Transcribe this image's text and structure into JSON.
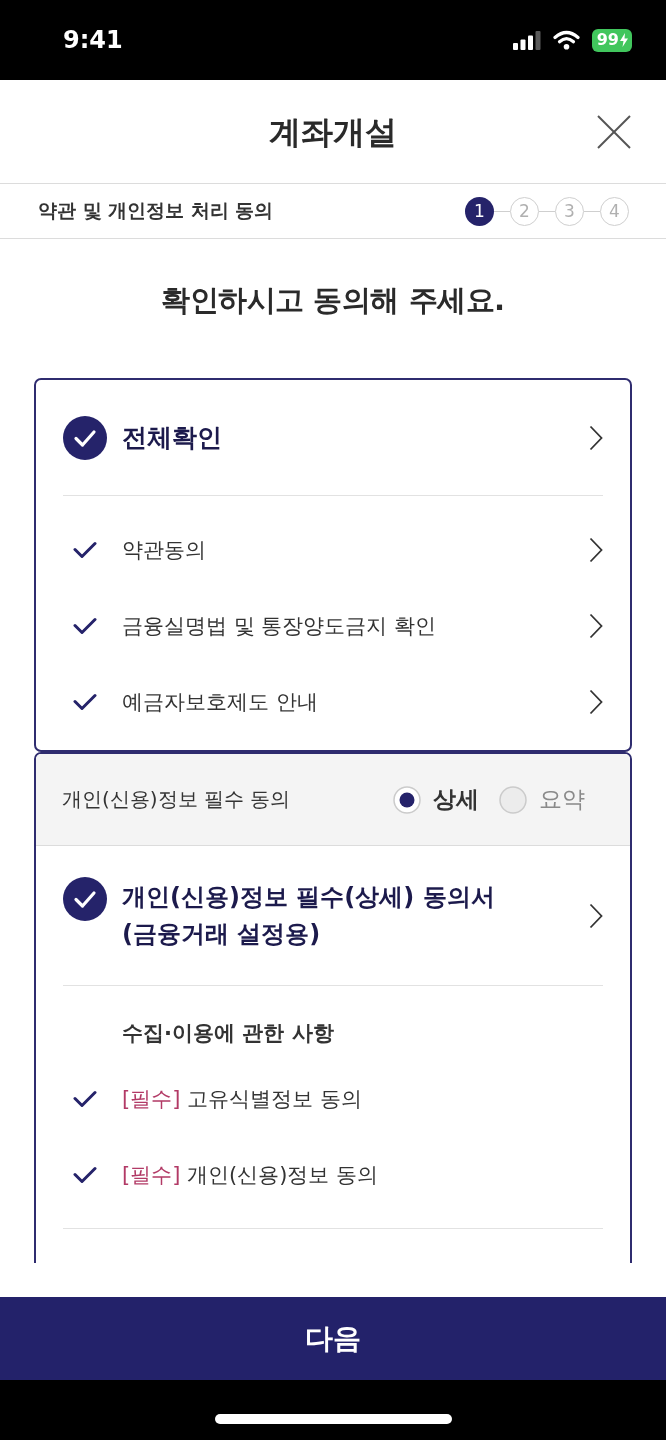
{
  "status_bar": {
    "time": "9:41",
    "battery": "99"
  },
  "header": {
    "title": "계좌개설"
  },
  "stepper": {
    "label": "약관 및 개인정보 처리 동의",
    "steps": [
      {
        "number": "1",
        "selected": true
      },
      {
        "number": "2",
        "selected": false
      },
      {
        "number": "3",
        "selected": false
      },
      {
        "number": "4",
        "selected": false
      }
    ]
  },
  "heading": "확인하시고 동의해 주세요.",
  "agreement_card": {
    "all": {
      "label": "전체확인",
      "checked": true
    },
    "items": [
      {
        "label": "약관동의",
        "checked": true
      },
      {
        "label": "금융실명법 및 통장양도금지 확인",
        "checked": true
      },
      {
        "label": "예금자보호제도 안내",
        "checked": true
      }
    ]
  },
  "personal_info_card": {
    "title": "개인(신용)정보 필수 동의",
    "view_options": [
      {
        "label": "상세",
        "selected": true
      },
      {
        "label": "요약",
        "selected": false
      }
    ],
    "document": {
      "title": "개인(신용)정보 필수(상세) 동의서 (금융거래 설정용)",
      "checked": true
    },
    "sections": [
      {
        "title": "수집·이용에 관한 사항",
        "items": [
          {
            "tag": "[필수]",
            "label": "고유식별정보 동의",
            "checked": true
          },
          {
            "tag": "[필수]",
            "label": "개인(신용)정보 동의",
            "checked": true
          }
        ]
      }
    ]
  },
  "next_button": {
    "label": "다음"
  }
}
